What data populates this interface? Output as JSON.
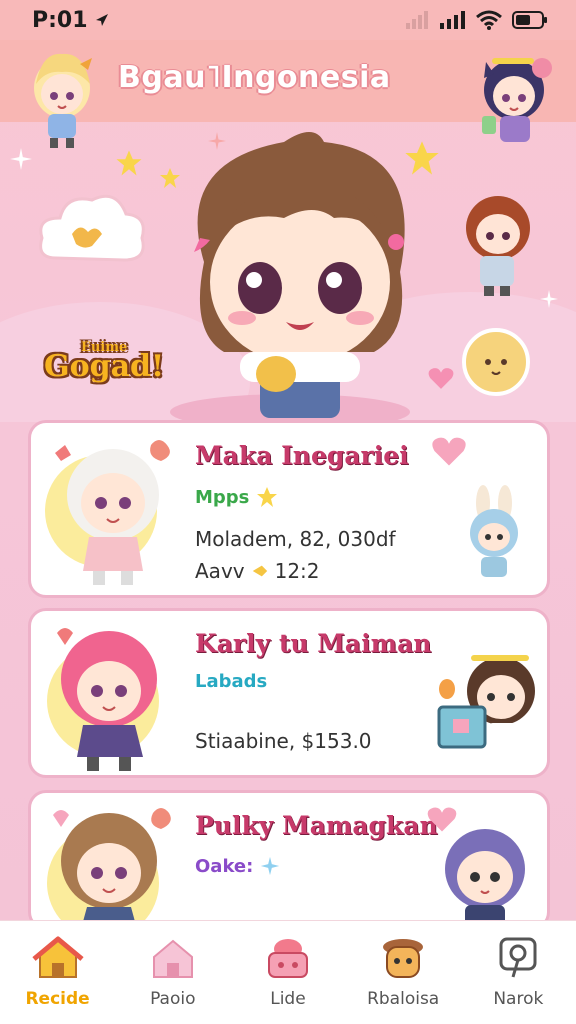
{
  "status_bar": {
    "time": "P:01"
  },
  "header": {
    "title": "Bgau˥Ingonesia"
  },
  "hero": {
    "badge_small": "Euime",
    "badge_main": "Gogad!"
  },
  "cards": [
    {
      "title": "Maka Inegariei",
      "tag": "Mpps",
      "tag_color": "#3aa84a",
      "line1": "Moladem, 82, 030df",
      "line2_label": "Aavv",
      "line2_value": "12:2"
    },
    {
      "title": "Karly tu Maiman",
      "tag": "Labads",
      "tag_color": "#27a9c2",
      "line1": "Stiaabine, $153.0"
    },
    {
      "title": "Pulky Mamagkan",
      "tag": "Oake:",
      "tag_color": "#8a4bc9"
    }
  ],
  "bottom_nav": [
    {
      "label": "Recide",
      "icon": "home-icon"
    },
    {
      "label": "Paoio",
      "icon": "house-icon"
    },
    {
      "label": "Lide",
      "icon": "cake-icon"
    },
    {
      "label": "Rbaloisa",
      "icon": "chibi-icon"
    },
    {
      "label": "Narok",
      "icon": "map-pin-icon"
    }
  ]
}
